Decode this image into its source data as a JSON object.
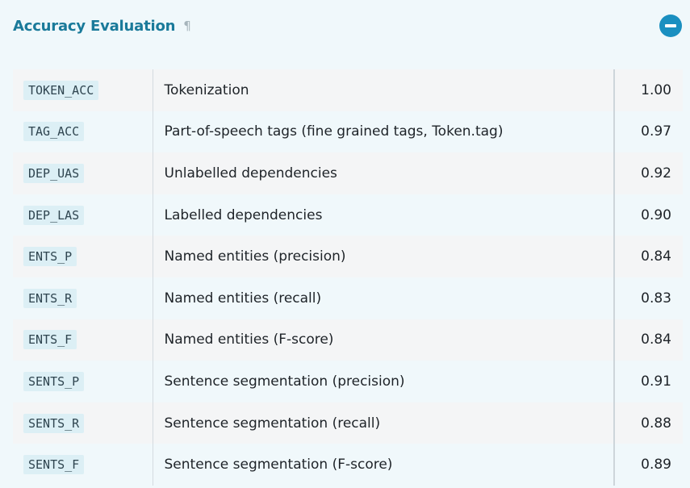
{
  "section": {
    "title": "Accuracy Evaluation",
    "anchor_symbol": "¶",
    "collapse_icon": "minus-circle-icon"
  },
  "colors": {
    "title": "#1a7a9a",
    "button": "#1a8fc0",
    "code_bg": "#dceff5"
  },
  "rows": [
    {
      "key": "TOKEN_ACC",
      "description": "Tokenization",
      "value": "1.00"
    },
    {
      "key": "TAG_ACC",
      "description": "Part-of-speech tags (fine grained tags, Token.tag)",
      "value": "0.97"
    },
    {
      "key": "DEP_UAS",
      "description": "Unlabelled dependencies",
      "value": "0.92"
    },
    {
      "key": "DEP_LAS",
      "description": "Labelled dependencies",
      "value": "0.90"
    },
    {
      "key": "ENTS_P",
      "description": "Named entities (precision)",
      "value": "0.84"
    },
    {
      "key": "ENTS_R",
      "description": "Named entities (recall)",
      "value": "0.83"
    },
    {
      "key": "ENTS_F",
      "description": "Named entities (F-score)",
      "value": "0.84"
    },
    {
      "key": "SENTS_P",
      "description": "Sentence segmentation (precision)",
      "value": "0.91"
    },
    {
      "key": "SENTS_R",
      "description": "Sentence segmentation (recall)",
      "value": "0.88"
    },
    {
      "key": "SENTS_F",
      "description": "Sentence segmentation (F-score)",
      "value": "0.89"
    }
  ]
}
